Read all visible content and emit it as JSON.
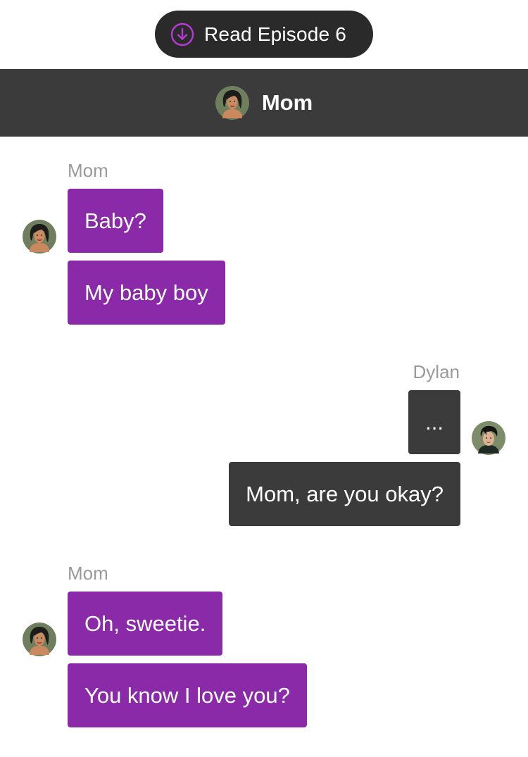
{
  "episode_button": {
    "label": "Read Episode 6",
    "icon": "circle-arrow-down-icon",
    "icon_color": "#b63ad6",
    "background": "#2a2a2a"
  },
  "header": {
    "title": "Mom",
    "background": "#3b3b3b"
  },
  "colors": {
    "mom_bubble": "#8a2aa8",
    "dylan_bubble": "#3b3b3b",
    "sender_name": "#9a9a9a"
  },
  "messages": [
    {
      "sender": "Mom",
      "side": "left",
      "bubbles": [
        "Baby?",
        "My baby boy"
      ]
    },
    {
      "sender": "Dylan",
      "side": "right",
      "bubbles": [
        "...",
        "Mom, are you okay?"
      ]
    },
    {
      "sender": "Mom",
      "side": "left",
      "bubbles": [
        "Oh, sweetie.",
        "You know I love you?"
      ]
    }
  ]
}
